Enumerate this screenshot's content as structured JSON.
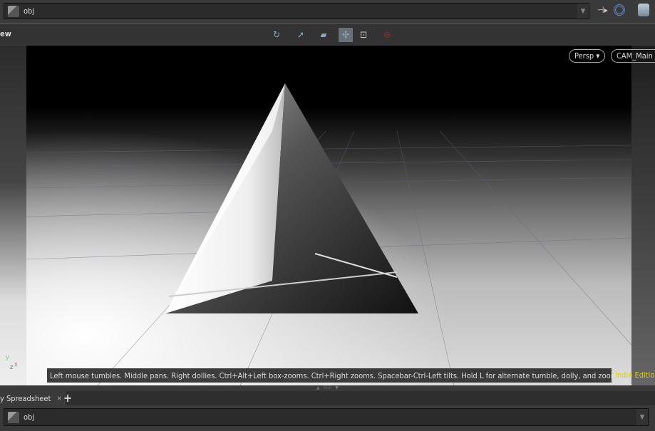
{
  "top_path": {
    "value": "obj"
  },
  "toolbar": {
    "left_label": "ew",
    "icons": [
      "tumble-icon",
      "select-icon",
      "transform-icon",
      "persp-toggle-icon",
      "zoom-icon",
      "disabled-icon"
    ]
  },
  "viewport": {
    "projection": "Persp",
    "camera": "CAM_Main",
    "hint": "Left mouse tumbles. Middle pans. Right dollies. Ctrl+Alt+Left box-zooms. Ctrl+Right zooms. Spacebar-Ctrl-Left tilts. Hold L for alternate tumble, dolly, and zoom.",
    "edition": "Indie Edition",
    "axes": {
      "y": "y",
      "z": "z",
      "x": "x"
    }
  },
  "bottom": {
    "tab_label": "y Spreadsheet",
    "close": "×",
    "add": "+",
    "path": "obj"
  },
  "colors": {
    "edition": "#e2d000",
    "background": "#3a3a3a"
  }
}
